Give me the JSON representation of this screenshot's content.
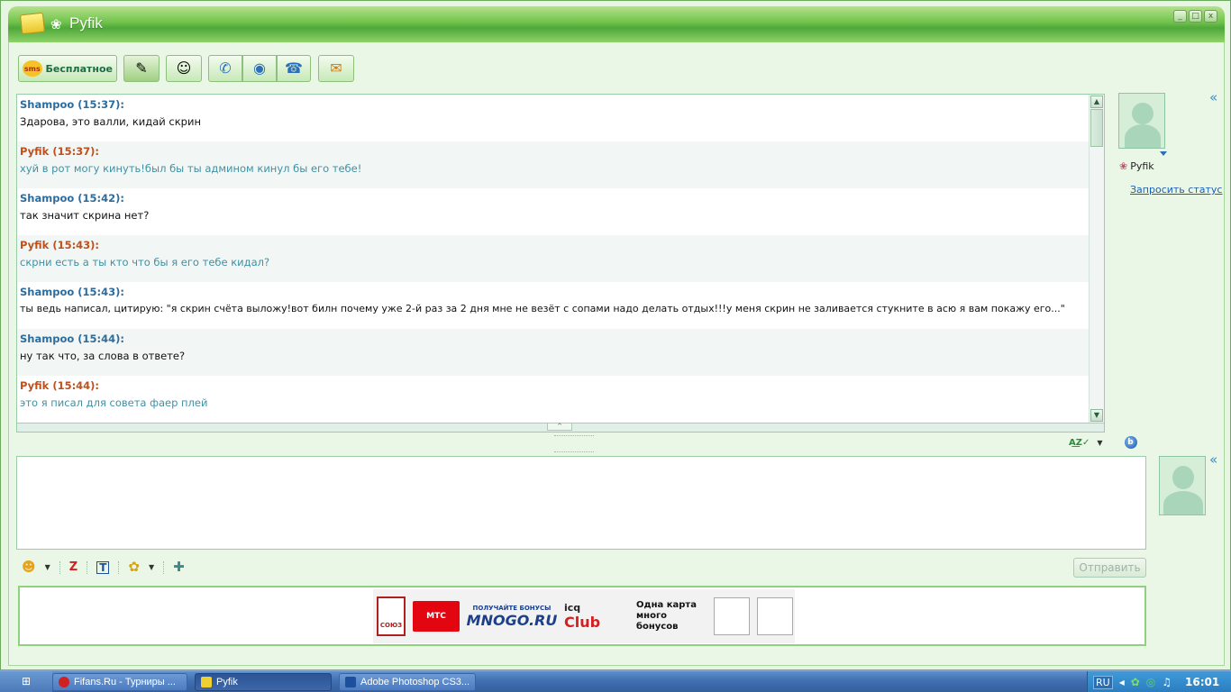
{
  "window": {
    "title": "Pyfik",
    "controls": [
      "_",
      "□",
      "x"
    ]
  },
  "toolbar": {
    "sms_badge": "sms",
    "sms_label": "Бесплатное",
    "icons": [
      "notes-icon",
      "contact-info-icon",
      "phone-icon",
      "video-icon",
      "fax-icon",
      "file-transfer-icon"
    ]
  },
  "messages": [
    {
      "author": "Shampoo",
      "time": "Shampoo (15:37):",
      "text": "Здарова, это валли, кидай скрин",
      "side": "shampoo"
    },
    {
      "author": "Pyfik",
      "time": "Pyfik (15:37):",
      "text": "хуй в рот могу кинуть!был бы ты админом кинул бы его тебе!",
      "side": "pyfik"
    },
    {
      "author": "Shampoo",
      "time": "Shampoo (15:42):",
      "text": "так значит скрина нет?",
      "side": "shampoo"
    },
    {
      "author": "Pyfik",
      "time": "Pyfik (15:43):",
      "text": "скрни есть а ты кто что бы я его тебе кидал?",
      "side": "pyfik"
    },
    {
      "author": "Shampoo",
      "time": "Shampoo (15:43):",
      "text": "ты ведь написал, цитирую: \"я скрин счёта выложу!вот билн почему уже 2-й раз за 2 дня мне не везёт с сопами надо делать отдых!!!у меня скрин не заливается стукните в асю я вам покажу его...\"",
      "side": "shampoo"
    },
    {
      "author": "Shampoo",
      "time": "Shampoo (15:44):",
      "text": "ну так что, за слова в ответе?",
      "side": "shampoo"
    },
    {
      "author": "Pyfik",
      "time": "Pyfik (15:44):",
      "text": "это я писал для совета фаер плей",
      "side": "pyfik"
    }
  ],
  "contact": {
    "name": "Pyfik",
    "request_status": "Запросить статус"
  },
  "compose": {
    "value": "",
    "send_label": "Отправить"
  },
  "ad": {
    "soyuz": "СОЮЗ",
    "mts": "МТС",
    "mnogo_top": "ПОЛУЧАЙТЕ БОНУСЫ",
    "mnogo_main": "MNOGO.RU",
    "icq_top": "icq",
    "icq_bottom": "Club",
    "card_text": "Одна карта много бонусов"
  },
  "taskbar": {
    "tasks": [
      {
        "label": "Fifans.Ru - Турниры ...",
        "active": false,
        "color": "#d02020"
      },
      {
        "label": "Pyfik",
        "active": true,
        "color": "#f0d030"
      },
      {
        "label": "Adobe Photoshop CS3...",
        "active": false,
        "color": "#1e4f9c"
      }
    ],
    "lang": "RU",
    "clock": "16:01"
  }
}
